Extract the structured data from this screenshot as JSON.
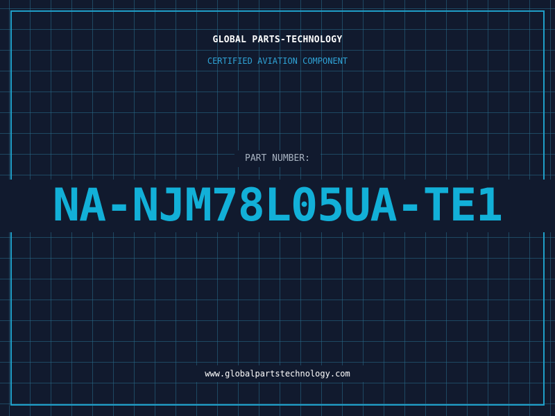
{
  "header": {
    "company": "GLOBAL PARTS-TECHNOLOGY",
    "subtitle": "CERTIFIED AVIATION COMPONENT"
  },
  "part": {
    "label": "PART NUMBER:",
    "number": "NA-NJM78L05UA-TE1"
  },
  "footer": {
    "url": "www.globalpartstechnology.com"
  },
  "colors": {
    "background": "#111a2e",
    "grid": "#286e8c",
    "frame": "#1f9fc8",
    "accent": "#12b0d8"
  }
}
